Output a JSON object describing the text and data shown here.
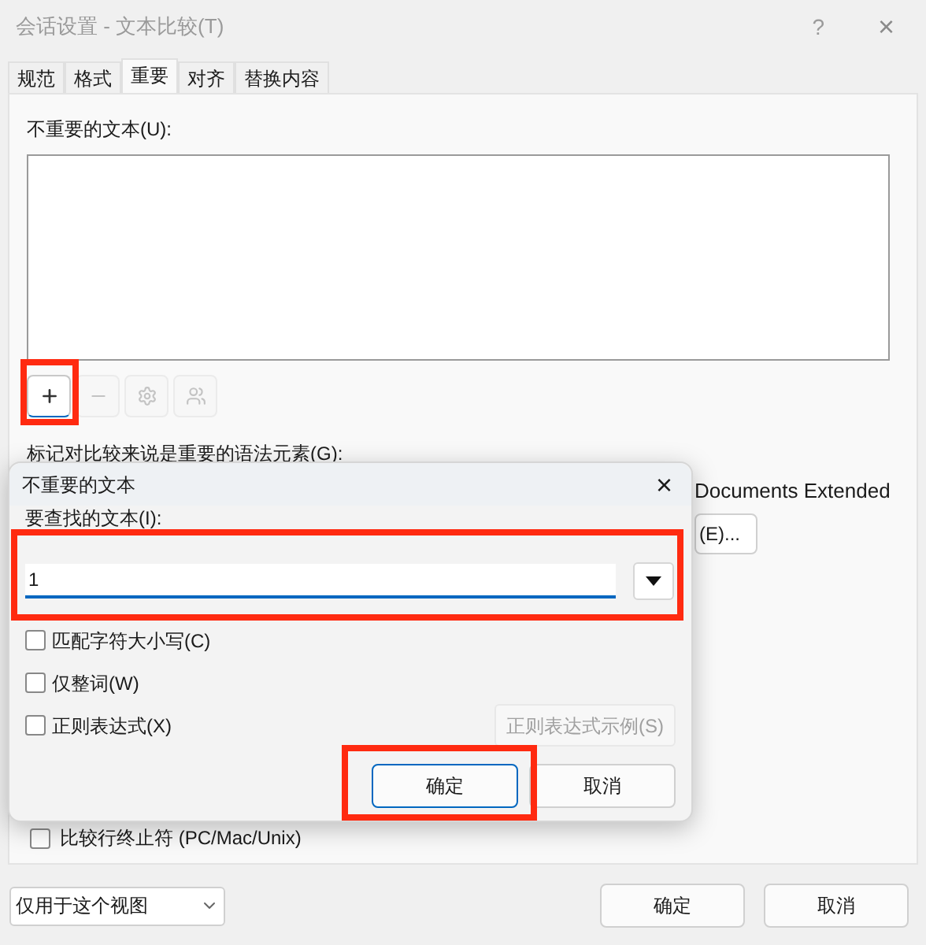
{
  "window": {
    "title": "会话设置 - 文本比较(T)",
    "help": "?",
    "close": "×"
  },
  "tabs": [
    {
      "label": "规范",
      "selected": false
    },
    {
      "label": "格式",
      "selected": false
    },
    {
      "label": "重要",
      "selected": true
    },
    {
      "label": "对齐",
      "selected": false
    },
    {
      "label": "替换内容",
      "selected": false
    }
  ],
  "unimportant_label": "不重要的文本(U):",
  "tool_buttons": [
    {
      "kind": "add",
      "disabled": false,
      "highlighted": true
    },
    {
      "kind": "remove",
      "disabled": true
    },
    {
      "kind": "settings",
      "disabled": true
    },
    {
      "kind": "users",
      "disabled": true
    }
  ],
  "grammar_label": "标记对比较来说是重要的语法元素(G):",
  "covered_text": "Documents Extended",
  "covered_button": "(E)...",
  "line_endings": {
    "label": "比较行终止符 (PC/Mac/Unix)",
    "checked": false
  },
  "scope": {
    "value": "仅用于这个视图"
  },
  "buttons": [
    "确定",
    "取消"
  ],
  "popup": {
    "title": "不重要的文本",
    "close": "×",
    "field_label": "要查找的文本(I):",
    "field_value": "1",
    "field_highlighted": true,
    "options": [
      {
        "label": "匹配字符大小写(C)",
        "checked": false
      },
      {
        "label": "仅整词(W)",
        "checked": false
      },
      {
        "label": "正则表达式(X)",
        "checked": false
      }
    ],
    "examples_button": {
      "label": "正则表达式示例(S)",
      "disabled": true
    },
    "buttons": [
      {
        "label": "确定",
        "highlighted": true
      },
      {
        "label": "取消"
      }
    ]
  }
}
